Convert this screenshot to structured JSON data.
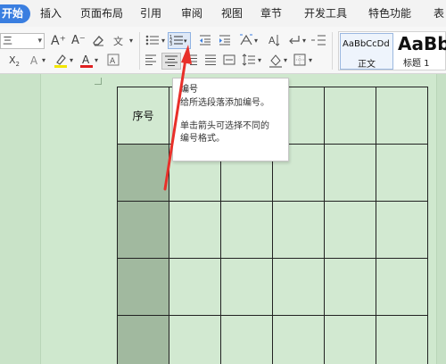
{
  "tabs": [
    {
      "label": "开始",
      "active": true
    },
    {
      "label": "插入"
    },
    {
      "label": "页面布局"
    },
    {
      "label": "引用"
    },
    {
      "label": "审阅"
    },
    {
      "label": "视图"
    },
    {
      "label": "章节"
    },
    {
      "label": "开发工具"
    },
    {
      "label": "特色功能"
    },
    {
      "label": "表"
    }
  ],
  "toolbar": {
    "font_size_value": "三",
    "styles": {
      "normal_sample": "AaBbCcDd",
      "normal_label": "正文",
      "heading1_sample": "AaBb",
      "heading1_label": "标题 1"
    }
  },
  "tooltip": {
    "title": "编号",
    "line1": "给所选段落添加编号。",
    "line2": "单击箭头可选择不同的",
    "line3": "编号格式。"
  },
  "table": {
    "header_first_cell": "序号"
  },
  "colors": {
    "accent": "#3a7ee0",
    "page_bg": "#cfe8ce",
    "shaded_cell": "#a1b99f",
    "arrow": "#e8302a"
  }
}
